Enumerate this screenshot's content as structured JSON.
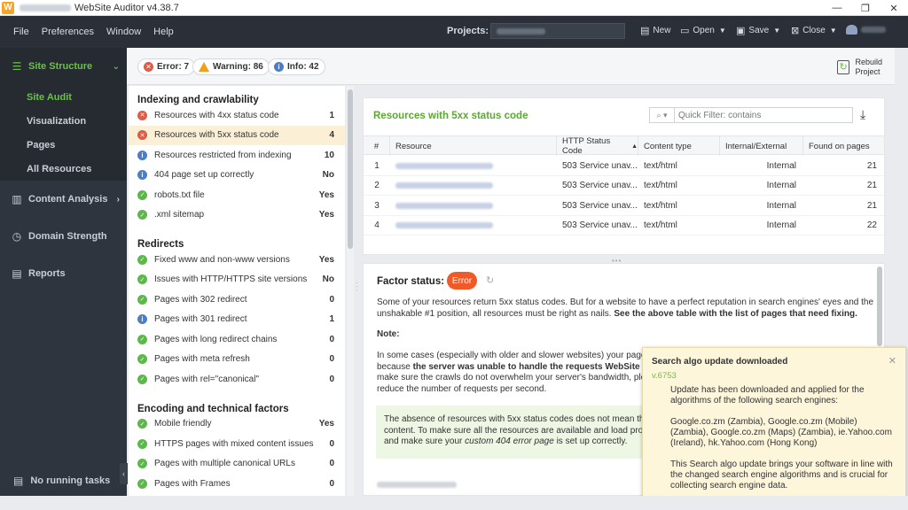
{
  "window": {
    "title": "WebSite Auditor v4.38.7",
    "logo_letter": "W"
  },
  "menu": [
    "File",
    "Preferences",
    "Window",
    "Help"
  ],
  "toolbar": {
    "projects_label": "Projects:",
    "new_label": "New",
    "open_label": "Open",
    "save_label": "Save",
    "close_label": "Close"
  },
  "sidebar": {
    "site_structure": "Site Structure",
    "sub_items": [
      "Site Audit",
      "Visualization",
      "Pages",
      "All Resources"
    ],
    "content_analysis": "Content Analysis",
    "domain_strength": "Domain Strength",
    "reports": "Reports",
    "footer": "No running tasks"
  },
  "summary": {
    "error": "Error: 7",
    "warning": "Warning: 86",
    "info": "Info: 42",
    "rebuild_line1": "Rebuild",
    "rebuild_line2": "Project"
  },
  "factors": {
    "section1": "Indexing and crawlability",
    "rows1": [
      {
        "label": "Resources with 4xx status code",
        "value": "1",
        "status": "error"
      },
      {
        "label": "Resources with 5xx status code",
        "value": "4",
        "status": "error"
      },
      {
        "label": "Resources restricted from indexing",
        "value": "10",
        "status": "info"
      },
      {
        "label": "404 page set up correctly",
        "value": "No",
        "status": "info"
      },
      {
        "label": "robots.txt file",
        "value": "Yes",
        "status": "ok"
      },
      {
        "label": ".xml sitemap",
        "value": "Yes",
        "status": "ok"
      }
    ],
    "section2": "Redirects",
    "rows2": [
      {
        "label": "Fixed www and non-www versions",
        "value": "Yes",
        "status": "ok"
      },
      {
        "label": "Issues with HTTP/HTTPS site versions",
        "value": "No",
        "status": "ok"
      },
      {
        "label": "Pages with 302 redirect",
        "value": "0",
        "status": "ok"
      },
      {
        "label": "Pages with 301 redirect",
        "value": "1",
        "status": "info"
      },
      {
        "label": "Pages with long redirect chains",
        "value": "0",
        "status": "ok"
      },
      {
        "label": "Pages with meta refresh",
        "value": "0",
        "status": "ok"
      },
      {
        "label": "Pages with rel=\"canonical\"",
        "value": "0",
        "status": "ok"
      }
    ],
    "section3": "Encoding and technical factors",
    "rows3": [
      {
        "label": "Mobile friendly",
        "value": "Yes",
        "status": "ok"
      },
      {
        "label": "HTTPS pages with mixed content issues",
        "value": "0",
        "status": "ok"
      },
      {
        "label": "Pages with multiple canonical URLs",
        "value": "0",
        "status": "ok"
      },
      {
        "label": "Pages with Frames",
        "value": "0",
        "status": "ok"
      }
    ]
  },
  "resources": {
    "title": "Resources with 5xx status code",
    "filter_placeholder": "Quick Filter: contains",
    "columns": [
      "#",
      "Resource",
      "HTTP Status Code",
      "Content type",
      "Internal/External",
      "Found on pages"
    ],
    "rows": [
      {
        "n": "1",
        "status": "503 Service unav...",
        "type": "text/html",
        "scope": "Internal",
        "found": "21"
      },
      {
        "n": "2",
        "status": "503 Service unav...",
        "type": "text/html",
        "scope": "Internal",
        "found": "21"
      },
      {
        "n": "3",
        "status": "503 Service unav...",
        "type": "text/html",
        "scope": "Internal",
        "found": "21"
      },
      {
        "n": "4",
        "status": "503 Service unav...",
        "type": "text/html",
        "scope": "Internal",
        "found": "22"
      }
    ]
  },
  "factor_status": {
    "label": "Factor status:",
    "badge": "Error",
    "para1": "Some of your resources return 5xx status codes. But for a website to have a perfect reputation in search engines' eyes and the unshakable #1 position, all resources must be right as nails.",
    "para1_bold": "See the above table with the list of pages that need fixing.",
    "note": "Note:",
    "para2a": "In some cases (especially with older and slower websites) your pages ar",
    "para2b": "because",
    "para2b_bold": "the server was unable to handle the requests WebSite Auditor",
    "para2c": "make sure the crawls do not overwhelm your server's bandwidth, please",
    "para2d": "reduce the number of requests per second.",
    "green1": "The absence of resources with 5xx status codes does not mean that us",
    "green2": "content. To make sure all the resources are available and load properly",
    "green3a": "and make sure your",
    "green3_italic": "custom 404 error page",
    "green3b": "is set up correctly."
  },
  "notification": {
    "title": "Search algo update downloaded",
    "version": "v.6753",
    "text1": "Update has been downloaded and applied for the algorithms of the following search engines:",
    "text2": "Google.co.zm (Zambia), Google.co.zm (Mobile) (Zambia), Google.co.zm (Maps) (Zambia), ie.Yahoo.com (Ireland), hk.Yahoo.com (Hong Kong)",
    "text3": "This Search algo update brings your software in line with the changed search engine algorithms and is crucial for collecting search engine data."
  },
  "colors": {
    "accent_green": "#6cc04a",
    "error_red": "#e05a47",
    "info_blue": "#4a7ec8",
    "badge_orange": "#f05a28"
  }
}
